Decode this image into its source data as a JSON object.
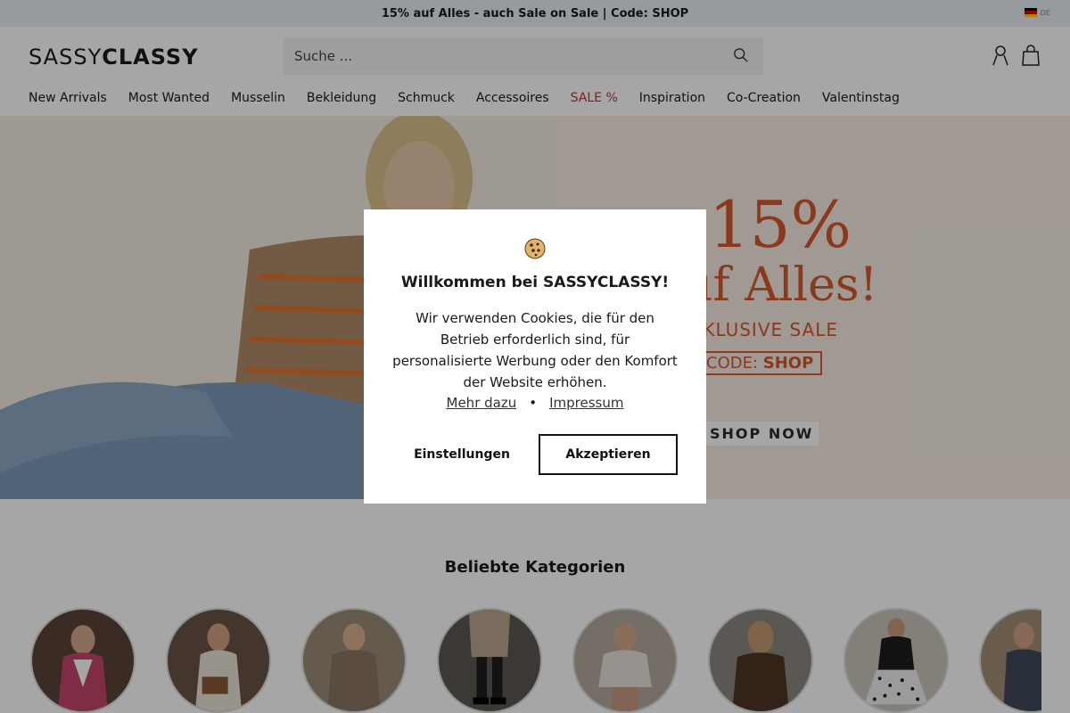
{
  "announcement": {
    "text": "15% auf Alles - auch Sale on Sale | Code: SHOP"
  },
  "language": {
    "code": "DE",
    "flag": "germany-flag"
  },
  "header": {
    "logo_part1": "SASSY",
    "logo_part2": "CLASSY",
    "search_placeholder": "Suche ..."
  },
  "nav": {
    "items": [
      "New Arrivals",
      "Most Wanted",
      "Musselin",
      "Bekleidung",
      "Schmuck",
      "Accessoires",
      "SALE %",
      "Inspiration",
      "Co-Creation",
      "Valentinstag"
    ]
  },
  "hero": {
    "percent": "15%",
    "headline": "auf Alles!",
    "subline": "EXKLUSIVE SALE",
    "code_label": "CODE:",
    "code_value": "SHOP",
    "cta": "SHOP NOW"
  },
  "categories": {
    "title": "Beliebte Kategorien"
  },
  "cookie_modal": {
    "icon": "cookie-icon",
    "title": "Willkommen bei SASSYCLASSY!",
    "body": "Wir verwenden Cookies, die für den Betrieb erforderlich sind, für personalisierte Werbung oder den Komfort der Website erhöhen.",
    "link_more": "Mehr dazu",
    "separator": "•",
    "link_imprint": "Impressum",
    "settings_label": "Einstellungen",
    "accept_label": "Akzeptieren"
  },
  "colors": {
    "accent_sale": "#b03a3a",
    "hero_orange": "#d4592a",
    "topbar_bg": "#e9eef1"
  }
}
